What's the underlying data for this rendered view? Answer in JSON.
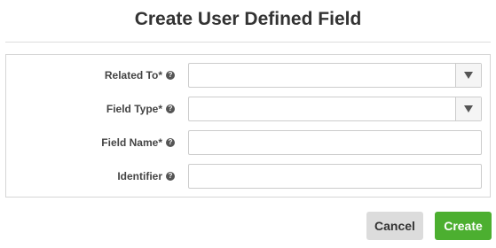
{
  "dialog": {
    "title": "Create User Defined Field"
  },
  "form": {
    "fields": [
      {
        "label": "Related To*",
        "type": "select",
        "value": "",
        "help_icon": "question-circle-icon"
      },
      {
        "label": "Field Type*",
        "type": "select",
        "value": "",
        "help_icon": "question-circle-icon"
      },
      {
        "label": "Field Name*",
        "type": "text",
        "value": "",
        "help_icon": "question-circle-icon"
      },
      {
        "label": "Identifier",
        "type": "text",
        "value": "",
        "help_icon": "question-circle-icon"
      }
    ],
    "help_glyph": "?"
  },
  "actions": {
    "cancel_label": "Cancel",
    "create_label": "Create"
  },
  "colors": {
    "create_button": "#4caf30",
    "cancel_button": "#dcdcdc"
  }
}
